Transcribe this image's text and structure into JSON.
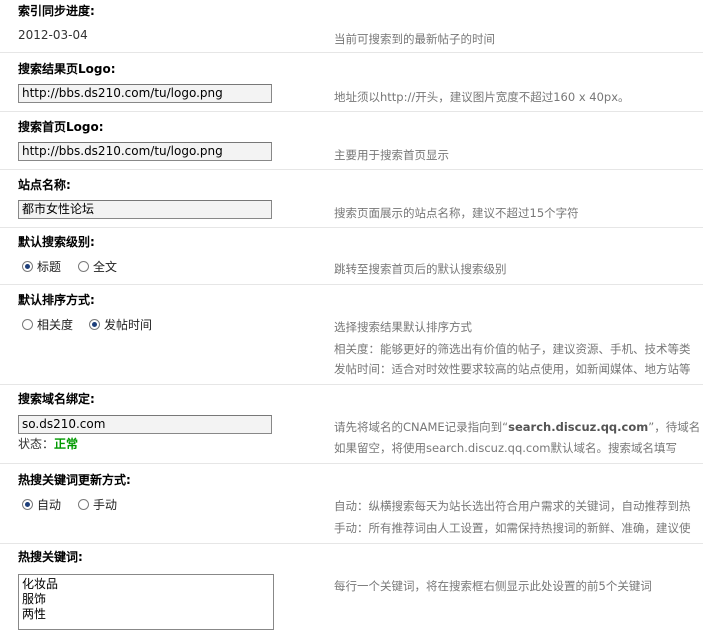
{
  "sync": {
    "label": "索引同步进度:",
    "value": "2012-03-04",
    "tip": "当前可搜索到的最新帖子的时间"
  },
  "result_logo": {
    "label": "搜索结果页Logo:",
    "value": "http://bbs.ds210.com/tu/logo.png",
    "tip": "地址须以http://开头，建议图片宽度不超过160 x 40px。"
  },
  "home_logo": {
    "label": "搜索首页Logo:",
    "value": "http://bbs.ds210.com/tu/logo.png",
    "tip": "主要用于搜索首页显示"
  },
  "site_name": {
    "label": "站点名称:",
    "value": "都市女性论坛",
    "tip": "搜索页面展示的站点名称，建议不超过15个字符"
  },
  "search_level": {
    "label": "默认搜索级别:",
    "options": [
      "标题",
      "全文"
    ],
    "selected": "标题",
    "tip": "跳转至搜索首页后的默认搜索级别"
  },
  "sort": {
    "label": "默认排序方式:",
    "options": [
      "相关度",
      "发帖时间"
    ],
    "selected": "发帖时间",
    "tip1": "选择搜索结果默认排序方式",
    "tip2": "相关度：能够更好的筛选出有价值的帖子，建议资源、手机、技术等类",
    "tip3": "发帖时间：适合对时效性要求较高的站点使用，如新闻媒体、地方站等"
  },
  "domain": {
    "label": "搜索域名绑定:",
    "value": "so.ds210.com",
    "status_label": "状态：",
    "status_value": "正常",
    "tip1_pre": "请先将域名的CNAME记录指向到“",
    "tip1_bold": "search.discuz.qq.com",
    "tip1_post": "”，待域名",
    "tip2": "如果留空，将使用search.discuz.qq.com默认域名。搜索域名填写"
  },
  "hot_update": {
    "label": "热搜关键词更新方式:",
    "options": [
      "自动",
      "手动"
    ],
    "selected": "自动",
    "tip1": "自动：纵横搜索每天为站长选出符合用户需求的关键词，自动推荐到热",
    "tip2": "手动：所有推荐词由人工设置，如需保持热搜词的新鲜、准确，建议使"
  },
  "hot_keywords": {
    "label": "热搜关键词:",
    "lines": [
      "化妆品",
      "服饰",
      "两性"
    ],
    "tip": "每行一个关键词，将在搜索框右侧显示此处设置的前5个关键词"
  }
}
